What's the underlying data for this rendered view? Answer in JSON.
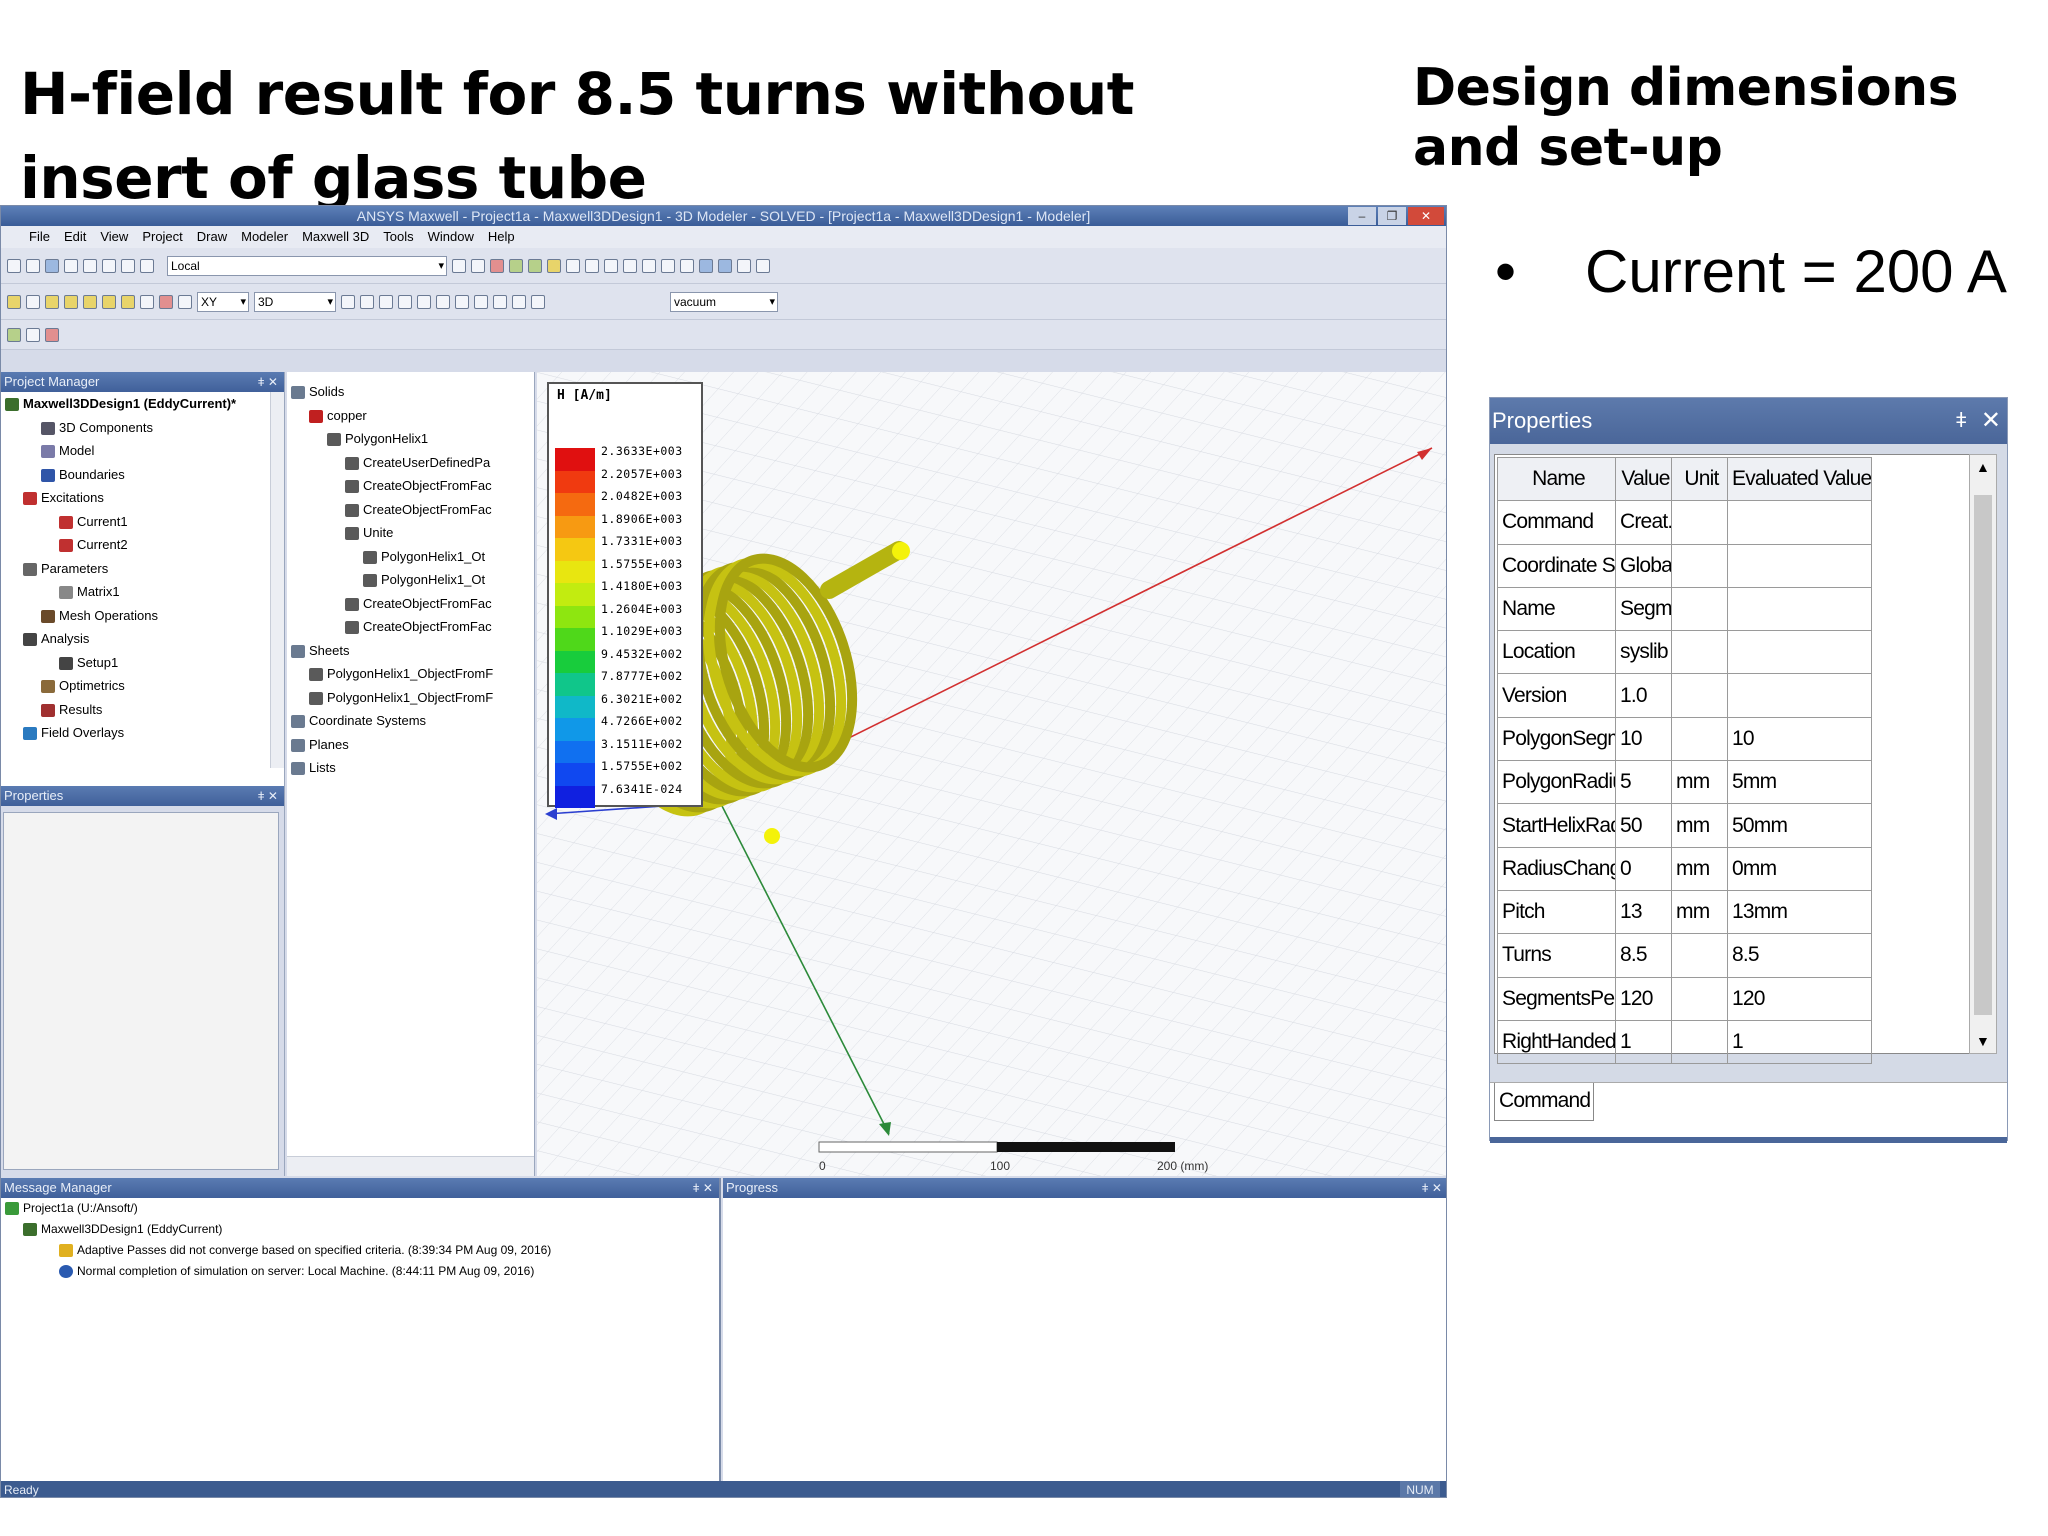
{
  "slide": {
    "title": "H-field result for 8.5 turns without insert of glass tube",
    "side_title": "Design dimensions and set-up",
    "bullet": "Current = 200 A"
  },
  "app": {
    "window_title": "ANSYS Maxwell - Project1a - Maxwell3DDesign1 - 3D Modeler - SOLVED - [Project1a - Maxwell3DDesign1 - Modeler]",
    "menu": [
      "File",
      "Edit",
      "View",
      "Project",
      "Draw",
      "Modeler",
      "Maxwell 3D",
      "Tools",
      "Window",
      "Help"
    ],
    "coord_system": "Local",
    "plane": "XY",
    "dimension": "3D",
    "material": "vacuum",
    "project_manager": {
      "title": "Project Manager",
      "items": [
        {
          "label": "Maxwell3DDesign1 (EddyCurrent)*",
          "indent": 0,
          "icon": "design-icon"
        },
        {
          "label": "3D Components",
          "indent": 2,
          "icon": "components-icon"
        },
        {
          "label": "Model",
          "indent": 2,
          "icon": "model-icon"
        },
        {
          "label": "Boundaries",
          "indent": 2,
          "icon": "boundaries-icon"
        },
        {
          "label": "Excitations",
          "indent": 1,
          "icon": "excitations-icon"
        },
        {
          "label": "Current1",
          "indent": 3,
          "icon": "current-icon"
        },
        {
          "label": "Current2",
          "indent": 3,
          "icon": "current-icon"
        },
        {
          "label": "Parameters",
          "indent": 1,
          "icon": "parameters-icon"
        },
        {
          "label": "Matrix1",
          "indent": 3,
          "icon": "matrix-icon"
        },
        {
          "label": "Mesh Operations",
          "indent": 2,
          "icon": "mesh-icon"
        },
        {
          "label": "Analysis",
          "indent": 1,
          "icon": "analysis-icon"
        },
        {
          "label": "Setup1",
          "indent": 3,
          "icon": "setup-icon"
        },
        {
          "label": "Optimetrics",
          "indent": 2,
          "icon": "optimetrics-icon"
        },
        {
          "label": "Results",
          "indent": 2,
          "icon": "results-icon"
        },
        {
          "label": "Field Overlays",
          "indent": 1,
          "icon": "field-overlays-icon"
        }
      ]
    },
    "properties_panel_title": "Properties",
    "history_tree": [
      {
        "label": "Solids",
        "indent": 0
      },
      {
        "label": "copper",
        "indent": 1
      },
      {
        "label": "PolygonHelix1",
        "indent": 2
      },
      {
        "label": "CreateUserDefinedPa",
        "indent": 3
      },
      {
        "label": "CreateObjectFromFac",
        "indent": 3
      },
      {
        "label": "CreateObjectFromFac",
        "indent": 3
      },
      {
        "label": "Unite",
        "indent": 3
      },
      {
        "label": "PolygonHelix1_Ot",
        "indent": 4
      },
      {
        "label": "PolygonHelix1_Ot",
        "indent": 4
      },
      {
        "label": "CreateObjectFromFac",
        "indent": 3
      },
      {
        "label": "CreateObjectFromFac",
        "indent": 3
      },
      {
        "label": "Sheets",
        "indent": 0
      },
      {
        "label": "PolygonHelix1_ObjectFromF",
        "indent": 1
      },
      {
        "label": "PolygonHelix1_ObjectFromF",
        "indent": 1
      },
      {
        "label": "Coordinate Systems",
        "indent": 0
      },
      {
        "label": "Planes",
        "indent": 0
      },
      {
        "label": "Lists",
        "indent": 0
      }
    ],
    "legend": {
      "title": "H [A/m]",
      "labels": [
        "2.3633E+003",
        "2.2057E+003",
        "2.0482E+003",
        "1.8906E+003",
        "1.7331E+003",
        "1.5755E+003",
        "1.4180E+003",
        "1.2604E+003",
        "1.1029E+003",
        "9.4532E+002",
        "7.8777E+002",
        "6.3021E+002",
        "4.7266E+002",
        "3.1511E+002",
        "1.5755E+002",
        "7.6341E-024"
      ],
      "colors": [
        "#e01010",
        "#f03a10",
        "#f56a10",
        "#f79a12",
        "#f5c812",
        "#e8e610",
        "#c2ec10",
        "#8ee610",
        "#4fd81a",
        "#18cc3c",
        "#10c68a",
        "#10b8c8",
        "#1098e8",
        "#1070f0",
        "#1048f0",
        "#1020e0"
      ]
    },
    "scale_labels": [
      "0",
      "100",
      "200 (mm)"
    ],
    "message_manager": {
      "title": "Message Manager",
      "items": [
        {
          "label": "Project1a (U:/Ansoft/)",
          "indent": 0,
          "icon": "project-icon"
        },
        {
          "label": "Maxwell3DDesign1 (EddyCurrent)",
          "indent": 1,
          "icon": "design-icon"
        },
        {
          "label": "Adaptive Passes did not converge based on specified criteria. (8:39:34 PM  Aug 09, 2016)",
          "indent": 3,
          "icon": "warning-icon"
        },
        {
          "label": "Normal completion of simulation on server: Local Machine. (8:44:11 PM  Aug 09, 2016)",
          "indent": 3,
          "icon": "info-icon"
        }
      ]
    },
    "progress_title": "Progress",
    "status": "Ready",
    "status_num": "NUM"
  },
  "properties": {
    "title": "Properties",
    "columns": [
      "Name",
      "Value",
      "Unit",
      "Evaluated Value"
    ],
    "rows": [
      [
        "Command",
        "Creat...",
        "",
        ""
      ],
      [
        "Coordinate Syst...",
        "Global",
        "",
        ""
      ],
      [
        "Name",
        "Segm...",
        "",
        ""
      ],
      [
        "Location",
        "syslib",
        "",
        ""
      ],
      [
        "Version",
        "1.0",
        "",
        ""
      ],
      [
        "PolygonSegments",
        "10",
        "",
        "10"
      ],
      [
        "PolygonRadius",
        "5",
        "mm",
        "5mm"
      ],
      [
        "StartHelixRadius",
        "50",
        "mm",
        "50mm"
      ],
      [
        "RadiusChange",
        "0",
        "mm",
        "0mm"
      ],
      [
        "Pitch",
        "13",
        "mm",
        "13mm"
      ],
      [
        "Turns",
        "8.5",
        "",
        "8.5"
      ],
      [
        "SegmentsPerTurn",
        "120",
        "",
        "120"
      ],
      [
        "RightHanded",
        "1",
        "",
        "1"
      ]
    ],
    "tab": "Command"
  }
}
